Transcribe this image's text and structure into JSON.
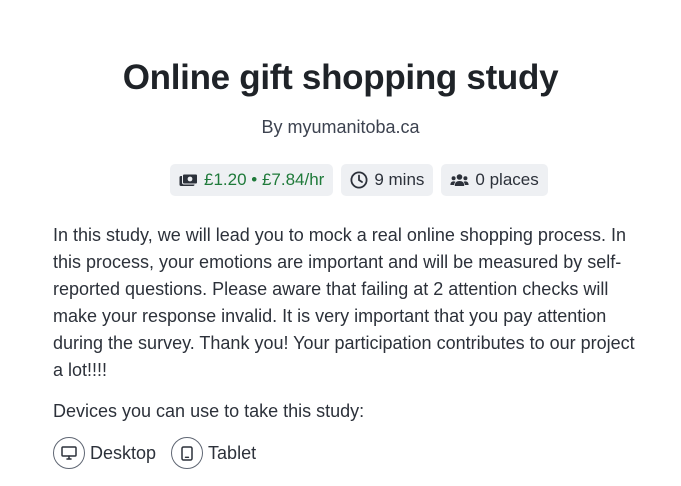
{
  "study": {
    "title": "Online gift shopping study",
    "byline": "By myumanitoba.ca",
    "description": "In this study, we will lead you to mock a real online shopping process. In this process, your emotions are important and will be measured by self-reported questions. Please aware that failing at 2 attention checks will make your response invalid. It is very important that you pay attention during the survey. Thank you! Your participation contributes to our project a lot!!!!"
  },
  "badges": {
    "reward": {
      "text": "£1.20 • £7.84/hr",
      "icon": "cash-icon",
      "color": "#1f7a3a"
    },
    "duration": {
      "text": "9 mins",
      "icon": "clock-icon"
    },
    "places": {
      "text": "0 places",
      "icon": "users-icon"
    }
  },
  "devices": {
    "label": "Devices you can use to take this study:",
    "items": [
      {
        "label": "Desktop",
        "icon": "desktop-icon"
      },
      {
        "label": "Tablet",
        "icon": "tablet-icon"
      }
    ]
  }
}
